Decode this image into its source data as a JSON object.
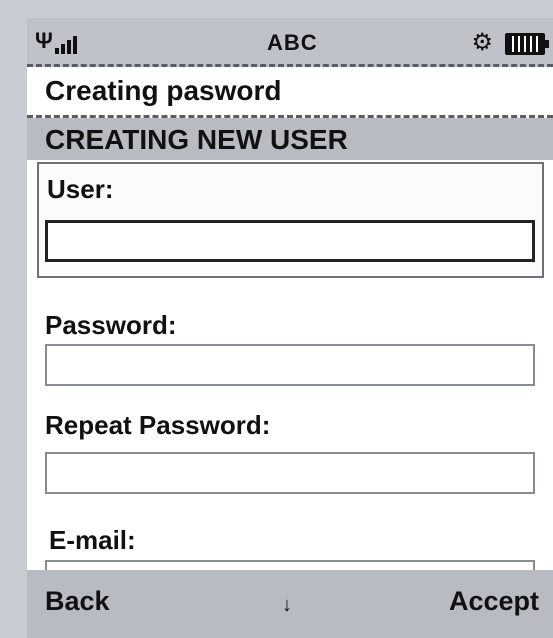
{
  "status": {
    "signal_icon": "Ψ",
    "input_mode": "ABC",
    "settings_icon": "⚙",
    "battery_icon": "battery-icon"
  },
  "title": "Creating pasword",
  "header": "CREATING NEW USER",
  "form": {
    "user_label": "User:",
    "user_value": "",
    "password_label": "Password:",
    "password_value": "",
    "repeat_password_label": "Repeat Password:",
    "repeat_password_value": "",
    "email_label": "E-mail:",
    "email_value": ""
  },
  "softkeys": {
    "left": "Back",
    "middle": "↓",
    "right": "Accept"
  },
  "colors": {
    "bar_gray": "#b8bcc2",
    "text": "#111111",
    "background": "#ffffff"
  }
}
